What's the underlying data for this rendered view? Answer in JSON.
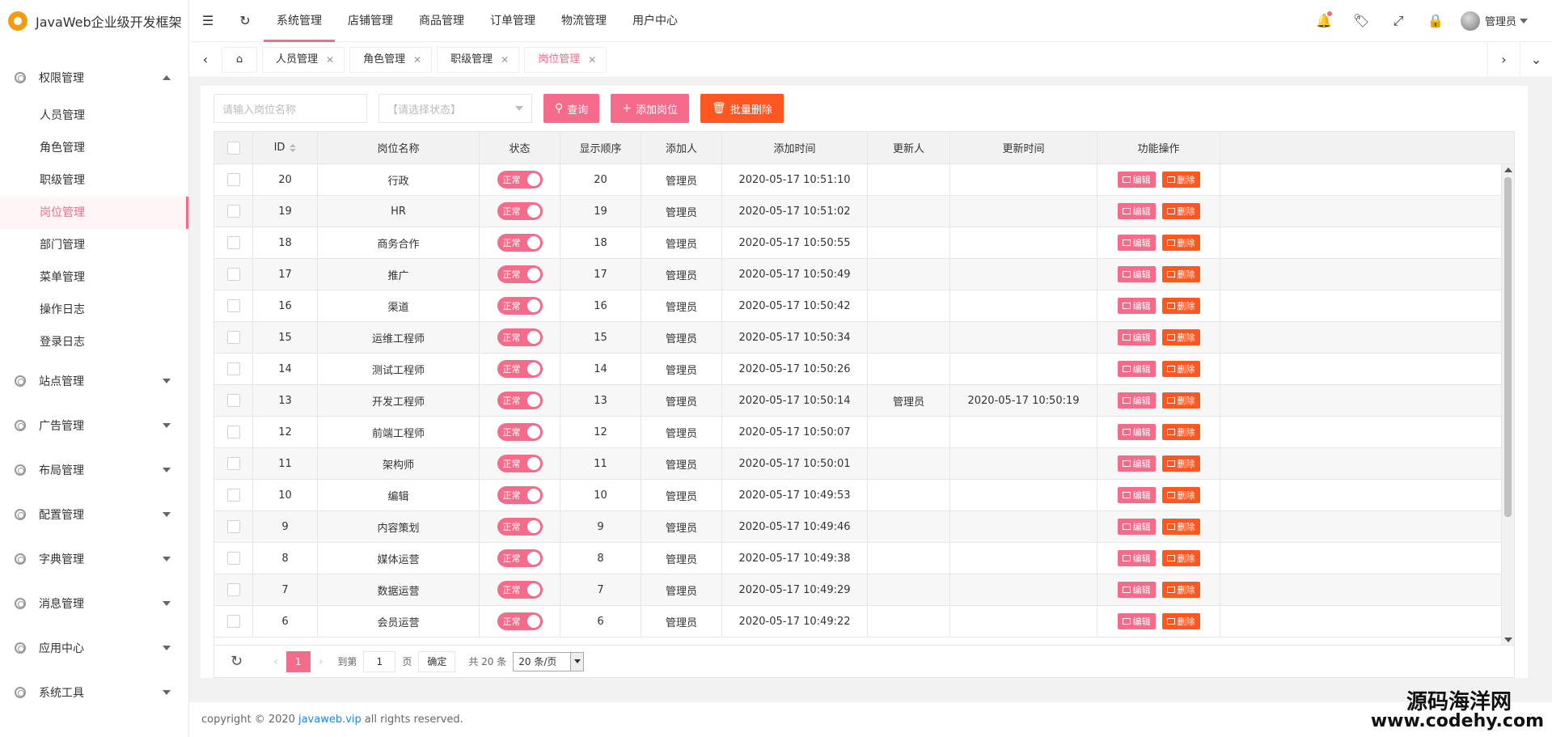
{
  "app": {
    "title": "JavaWeb企业级开发框架"
  },
  "sidebar": {
    "groups": [
      {
        "label": "权限管理",
        "expanded": true,
        "items": [
          "人员管理",
          "角色管理",
          "职级管理",
          "岗位管理",
          "部门管理",
          "菜单管理",
          "操作日志",
          "登录日志"
        ],
        "active": "岗位管理"
      },
      {
        "label": "站点管理"
      },
      {
        "label": "广告管理"
      },
      {
        "label": "布局管理"
      },
      {
        "label": "配置管理"
      },
      {
        "label": "字典管理"
      },
      {
        "label": "消息管理"
      },
      {
        "label": "应用中心"
      },
      {
        "label": "系统工具"
      }
    ]
  },
  "header": {
    "nav": [
      "系统管理",
      "店铺管理",
      "商品管理",
      "订单管理",
      "物流管理",
      "用户中心"
    ],
    "active_nav": "系统管理",
    "user": "管理员"
  },
  "tabs": {
    "items": [
      "人员管理",
      "角色管理",
      "职级管理",
      "岗位管理"
    ],
    "active": "岗位管理"
  },
  "search": {
    "name_placeholder": "请输入岗位名称",
    "status_placeholder": "【请选择状态】",
    "query_label": "查询",
    "add_label": "添加岗位",
    "batch_delete_label": "批量删除"
  },
  "table": {
    "columns": [
      "ID",
      "岗位名称",
      "状态",
      "显示顺序",
      "添加人",
      "添加时间",
      "更新人",
      "更新时间",
      "功能操作"
    ],
    "status_label": "正常",
    "edit_label": "编辑",
    "delete_label": "删除",
    "rows": [
      {
        "id": "20",
        "name": "行政",
        "order": "20",
        "creator": "管理员",
        "created": "2020-05-17 10:51:10",
        "updater": "",
        "updated": ""
      },
      {
        "id": "19",
        "name": "HR",
        "order": "19",
        "creator": "管理员",
        "created": "2020-05-17 10:51:02",
        "updater": "",
        "updated": ""
      },
      {
        "id": "18",
        "name": "商务合作",
        "order": "18",
        "creator": "管理员",
        "created": "2020-05-17 10:50:55",
        "updater": "",
        "updated": ""
      },
      {
        "id": "17",
        "name": "推广",
        "order": "17",
        "creator": "管理员",
        "created": "2020-05-17 10:50:49",
        "updater": "",
        "updated": ""
      },
      {
        "id": "16",
        "name": "渠道",
        "order": "16",
        "creator": "管理员",
        "created": "2020-05-17 10:50:42",
        "updater": "",
        "updated": ""
      },
      {
        "id": "15",
        "name": "运维工程师",
        "order": "15",
        "creator": "管理员",
        "created": "2020-05-17 10:50:34",
        "updater": "",
        "updated": ""
      },
      {
        "id": "14",
        "name": "测试工程师",
        "order": "14",
        "creator": "管理员",
        "created": "2020-05-17 10:50:26",
        "updater": "",
        "updated": ""
      },
      {
        "id": "13",
        "name": "开发工程师",
        "order": "13",
        "creator": "管理员",
        "created": "2020-05-17 10:50:14",
        "updater": "管理员",
        "updated": "2020-05-17 10:50:19"
      },
      {
        "id": "12",
        "name": "前端工程师",
        "order": "12",
        "creator": "管理员",
        "created": "2020-05-17 10:50:07",
        "updater": "",
        "updated": ""
      },
      {
        "id": "11",
        "name": "架构师",
        "order": "11",
        "creator": "管理员",
        "created": "2020-05-17 10:50:01",
        "updater": "",
        "updated": ""
      },
      {
        "id": "10",
        "name": "编辑",
        "order": "10",
        "creator": "管理员",
        "created": "2020-05-17 10:49:53",
        "updater": "",
        "updated": ""
      },
      {
        "id": "9",
        "name": "内容策划",
        "order": "9",
        "creator": "管理员",
        "created": "2020-05-17 10:49:46",
        "updater": "",
        "updated": ""
      },
      {
        "id": "8",
        "name": "媒体运营",
        "order": "8",
        "creator": "管理员",
        "created": "2020-05-17 10:49:38",
        "updater": "",
        "updated": ""
      },
      {
        "id": "7",
        "name": "数据运营",
        "order": "7",
        "creator": "管理员",
        "created": "2020-05-17 10:49:29",
        "updater": "",
        "updated": ""
      },
      {
        "id": "6",
        "name": "会员运营",
        "order": "6",
        "creator": "管理员",
        "created": "2020-05-17 10:49:22",
        "updater": "",
        "updated": ""
      }
    ]
  },
  "pager": {
    "current": "1",
    "goto_label": "到第",
    "goto_value": "1",
    "page_label": "页",
    "confirm_label": "确定",
    "total_label": "共 20 条",
    "page_size": "20 条/页"
  },
  "footer": {
    "prefix": "copyright © 2020",
    "link": "javaweb.vip",
    "suffix": "all rights reserved."
  },
  "watermark": {
    "line1": "源码海洋网",
    "line2": "www.codehy.com"
  },
  "colors": {
    "accent": "#f56c8b",
    "danger": "#ff5722"
  }
}
